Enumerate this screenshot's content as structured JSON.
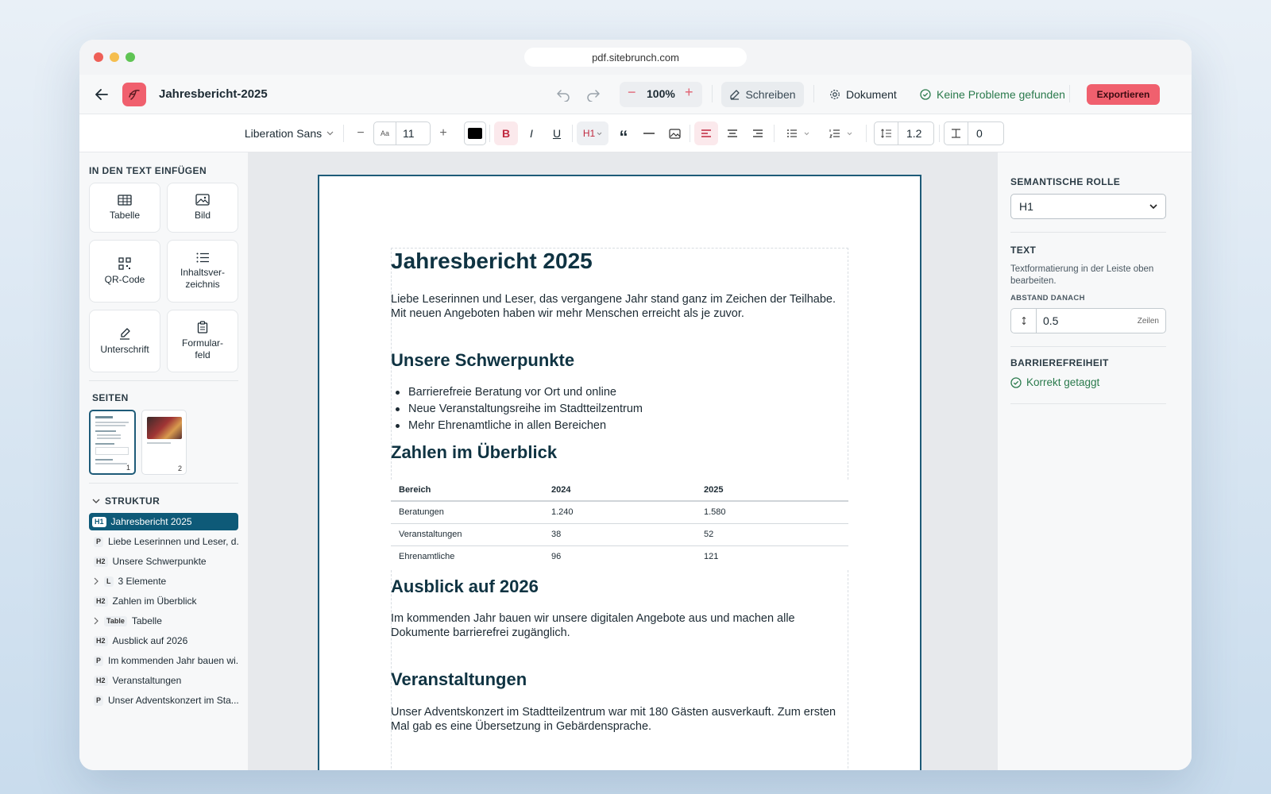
{
  "browser": {
    "url": "pdf.sitebrunch.com"
  },
  "app": {
    "back_icon": "arrow-left-icon",
    "logo_icon": "croissant-logo",
    "doc_title": "Jahresbericht-2025",
    "zoom": "100%",
    "mode_label": "Schreiben",
    "document_label": "Dokument",
    "status_label": "Keine Probleme gefunden",
    "export_label": "Exportieren",
    "accent": "#f0606e",
    "primary": "#0e5a78"
  },
  "toolbar": {
    "font_family": "Liberation Sans",
    "font_size_prefix": "Aa",
    "font_size": "11",
    "color": "#000000",
    "bold": "B",
    "italic": "I",
    "underline": "U",
    "heading": "H1",
    "quote": "“",
    "line_height": "1.2",
    "indent": "0"
  },
  "sidebar": {
    "insert_heading": "IN DEN TEXT EINFÜGEN",
    "insert_items": [
      {
        "label": "Tabelle",
        "icon": "table-icon"
      },
      {
        "label": "Bild",
        "icon": "image-icon"
      },
      {
        "label": "QR-Code",
        "icon": "qr-code-icon"
      },
      {
        "label": "Inhaltsver-\nzeichnis",
        "icon": "list-icon"
      },
      {
        "label": "Unterschrift",
        "icon": "pen-icon"
      },
      {
        "label": "Formular-\nfeld",
        "icon": "clipboard-icon"
      }
    ],
    "pages_heading": "SEITEN",
    "pages": [
      "1",
      "2"
    ],
    "structure_heading": "STRUKTUR",
    "structure": [
      {
        "tag": "H1",
        "label": "Jahresbericht 2025"
      },
      {
        "tag": "P",
        "label": "Liebe Leserinnen und Leser, d..."
      },
      {
        "tag": "H2",
        "label": "Unsere Schwerpunkte"
      },
      {
        "tag": "L",
        "label": "3 Elemente"
      },
      {
        "tag": "H2",
        "label": "Zahlen im Überblick"
      },
      {
        "tag": "Table",
        "label": "Tabelle"
      },
      {
        "tag": "H2",
        "label": "Ausblick auf 2026"
      },
      {
        "tag": "P",
        "label": "Im kommenden Jahr bauen wi..."
      },
      {
        "tag": "H2",
        "label": "Veranstaltungen"
      },
      {
        "tag": "P",
        "label": "Unser Adventskonzert im Sta..."
      }
    ]
  },
  "document": {
    "h1": "Jahresbericht 2025",
    "intro": "Liebe Leserinnen und Leser, das vergangene Jahr stand ganz im Zeichen der Teilhabe. Mit neuen Angeboten haben wir mehr Menschen erreicht als je zuvor.",
    "h2_focus": "Unsere Schwerpunkte",
    "bullets": [
      "Barrierefreie Beratung vor Ort und online",
      "Neue Veranstaltungsreihe im Stadtteilzentrum",
      "Mehr Ehrenamtliche in allen Bereichen"
    ],
    "h2_numbers": "Zahlen im Überblick",
    "table": [
      [
        "Bereich",
        "2024",
        "2025"
      ],
      [
        "Beratungen",
        "1.240",
        "1.580"
      ],
      [
        "Veranstaltungen",
        "38",
        "52"
      ],
      [
        "Ehrenamtliche",
        "96",
        "121"
      ]
    ],
    "h2_outlook": "Ausblick auf 2026",
    "outlook": "Im kommenden Jahr bauen wir unsere digitalen Angebote aus und machen alle Dokumente barrierefrei zugänglich.",
    "h2_events": "Veranstaltungen",
    "events": "Unser Adventskonzert im Stadtteilzentrum war mit 180 Gästen ausverkauft. Zum ersten Mal gab es eine Übersetzung in Gebärdensprache."
  },
  "right_panel": {
    "role_heading": "SEMANTISCHE ROLLE",
    "role_value": "H1",
    "text_heading": "TEXT",
    "text_hint": "Textformatierung in der Leiste oben bearbeiten.",
    "spacing_label": "ABSTAND DANACH",
    "spacing_value": "0.5",
    "spacing_unit": "Zeilen",
    "a11y_heading": "BARRIEREFREIHEIT",
    "a11y_status": "Korrekt getaggt"
  }
}
